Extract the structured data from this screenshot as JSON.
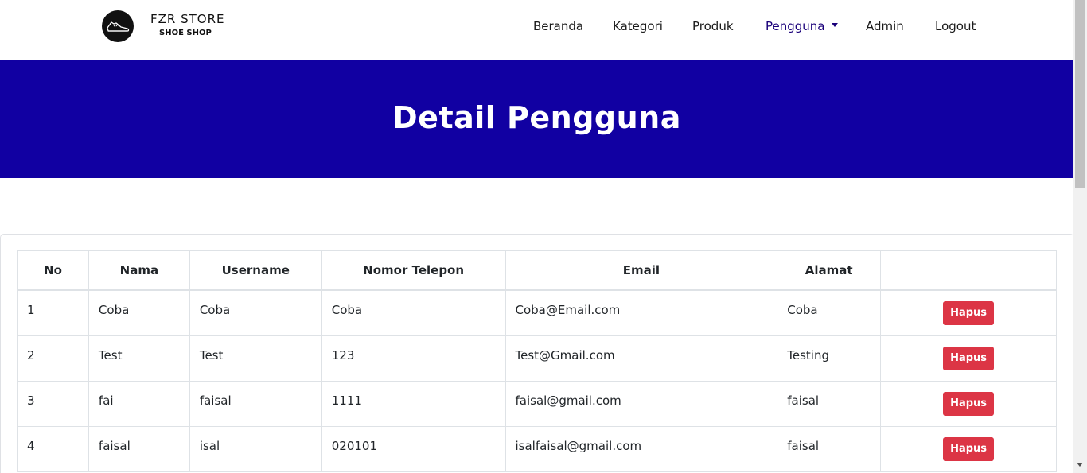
{
  "brand": {
    "title": "FZR STORE",
    "subtitle": "SHOE SHOP",
    "logo_icon": "sneaker-icon"
  },
  "nav": {
    "items": [
      {
        "label": "Beranda"
      },
      {
        "label": "Kategori"
      },
      {
        "label": "Produk"
      },
      {
        "label": "Pengguna",
        "active": true,
        "dropdown": true
      },
      {
        "label": "Admin"
      },
      {
        "label": "Logout"
      }
    ]
  },
  "banner": {
    "title": "Detail Pengguna",
    "color": "#1100a2"
  },
  "table": {
    "headers": [
      "No",
      "Nama",
      "Username",
      "Nomor Telepon",
      "Email",
      "Alamat",
      ""
    ],
    "rows": [
      {
        "no": "1",
        "nama": "Coba",
        "username": "Coba",
        "telepon": "Coba",
        "email": "Coba@Email.com",
        "alamat": "Coba",
        "action": "Hapus"
      },
      {
        "no": "2",
        "nama": "Test",
        "username": "Test",
        "telepon": "123",
        "email": "Test@Gmail.com",
        "alamat": "Testing",
        "action": "Hapus"
      },
      {
        "no": "3",
        "nama": "fai",
        "username": "faisal",
        "telepon": "1111",
        "email": "faisal@gmail.com",
        "alamat": "faisal",
        "action": "Hapus"
      },
      {
        "no": "4",
        "nama": "faisal",
        "username": "isal",
        "telepon": "020101",
        "email": "isalfaisal@gmail.com",
        "alamat": "faisal",
        "action": "Hapus"
      }
    ]
  },
  "colors": {
    "danger": "#dc3545",
    "nav_active": "#1a007a"
  }
}
